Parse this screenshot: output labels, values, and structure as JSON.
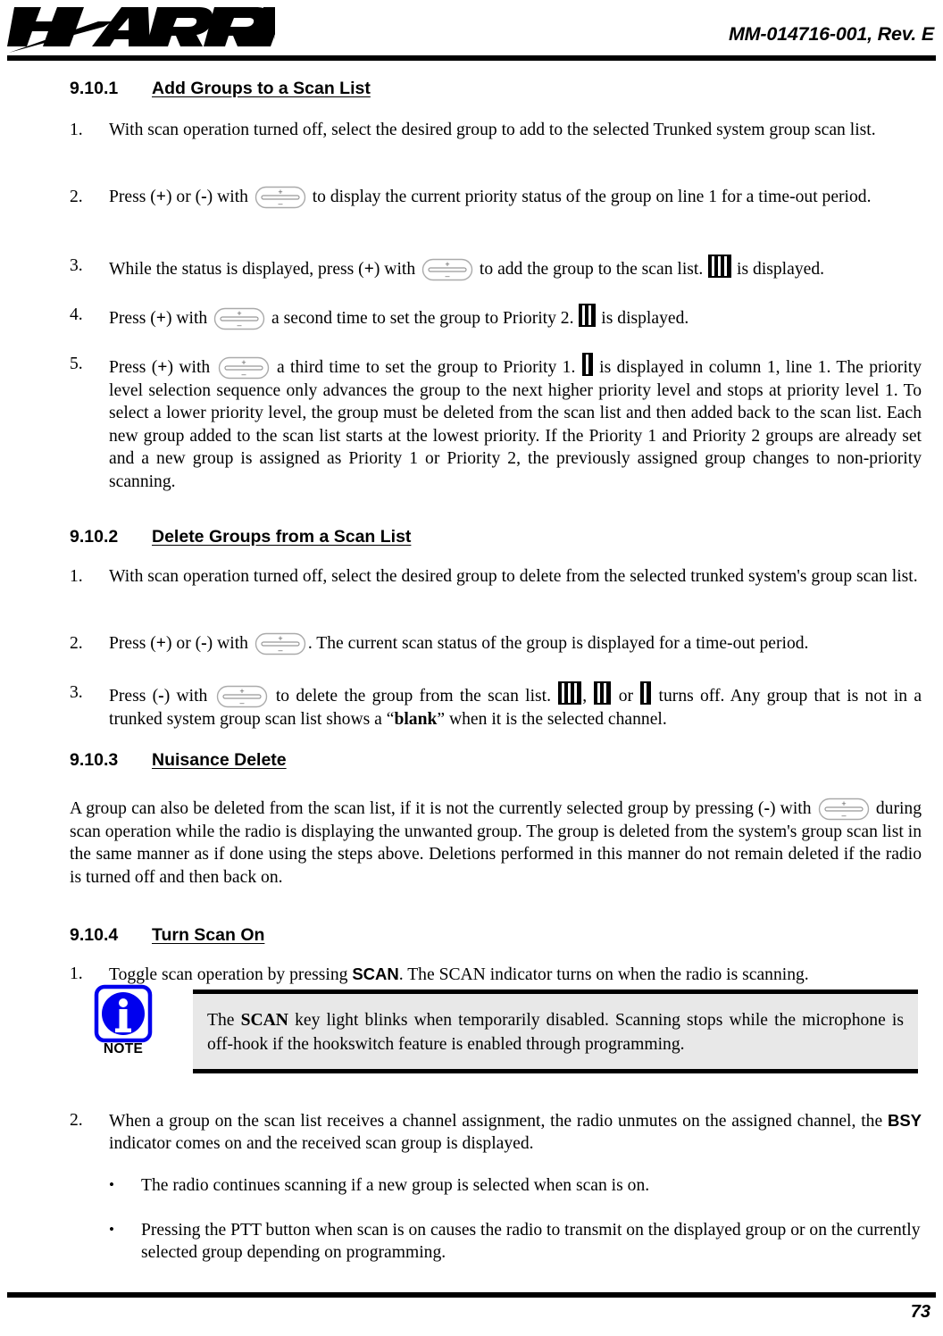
{
  "header": {
    "logo_text": "HARRIS",
    "logo_registered": "®",
    "document_id": "MM-014716-001, Rev. E"
  },
  "footer": {
    "page_number": "73"
  },
  "sections": [
    {
      "number": "9.10.1",
      "title": "Add Groups to a Scan List",
      "steps": [
        {
          "num": "1.",
          "text_a": "With scan operation turned off, select the desired group to add to the selected Trunked system group scan list."
        },
        {
          "num": "2.",
          "text_a": "Press (",
          "plus": "+",
          "text_b": ") or (",
          "minus": "-",
          "text_c": ") with ",
          "text_d": " to display the current priority status of the group on line 1 for a time-out period."
        },
        {
          "num": "3.",
          "text_a": "While the status is displayed, press (",
          "plus": "+",
          "text_c": ") with ",
          "text_d": " to add the group to the scan list. ",
          "text_e": " is displayed."
        },
        {
          "num": "4.",
          "text_a": "Press (",
          "plus": "+",
          "text_c": ") with ",
          "text_d": " a second time to set the group to Priority 2. ",
          "text_e": " is displayed."
        },
        {
          "num": "5.",
          "text_a": "Press (",
          "plus": "+",
          "text_c": ") with ",
          "text_d": " a third time to set the group to Priority 1. ",
          "text_e": " is displayed in column 1, line 1. The priority level selection sequence only advances the group to the next higher priority level and stops at priority level 1. To select a lower priority level, the group must be deleted from the scan list and then added back to the scan list. Each new group added to the scan list starts at the lowest priority. If the Priority 1 and Priority 2 groups are already set and a new group is assigned as Priority 1 or Priority 2, the previously assigned group changes to non-priority scanning."
        }
      ]
    },
    {
      "number": "9.10.2",
      "title": "Delete Groups from a Scan List",
      "steps": [
        {
          "num": "1.",
          "text_a": "With scan operation turned off, select the desired group to delete from the selected trunked system's group scan list."
        },
        {
          "num": "2.",
          "text_a": "Press (",
          "plus": "+",
          "text_b": ") or (",
          "minus": "-",
          "text_c": ") with ",
          "text_d": ". The current scan status of the group is displayed for a time-out period."
        },
        {
          "num": "3.",
          "text_a": "Press (",
          "minus": "-",
          "text_c": ") with ",
          "text_d": " to delete the group from the scan list. ",
          "sep1": ", ",
          "sep2": " or ",
          "text_e": " turns off. Any group that is not in a trunked system group scan list shows a “",
          "blank": "blank",
          "text_f": "” when it is the selected channel."
        }
      ]
    },
    {
      "number": "9.10.3",
      "title": "Nuisance Delete",
      "paragraph": {
        "text_a": "A group can also be deleted from the scan list, if it is not the currently selected group by pressing (",
        "minus": "-",
        "text_b": ") with ",
        "text_c": " during scan operation while the radio is displaying the unwanted group. The group is deleted from the system's group scan list in the same manner as if done using the steps above. Deletions performed in this manner do not remain deleted if the radio is turned off and then back on."
      }
    },
    {
      "number": "9.10.4",
      "title": "Turn Scan On",
      "steps": [
        {
          "num": "1.",
          "text_a": "Toggle scan operation by pressing ",
          "bold_scan": "SCAN",
          "text_b": ". The SCAN indicator turns on when the radio is scanning."
        },
        {
          "num": "2.",
          "text_a": "When a group on the scan list receives a channel assignment, the radio unmutes on the assigned channel, the ",
          "bold_bsy": "BSY",
          "text_b": " indicator comes on and the received scan group is displayed."
        }
      ],
      "bullets": [
        {
          "dot": "•",
          "text": "The radio continues scanning if a new group is selected when scan is on."
        },
        {
          "dot": "•",
          "text": "Pressing the PTT button when scan is on causes the radio to transmit on the displayed group or on the currently selected group depending on programming."
        }
      ]
    }
  ],
  "note": {
    "label": "NOTE",
    "icon": "info-icon",
    "text_a": "The ",
    "bold_scan": "SCAN",
    "text_b": " key light blinks when temporarily disabled. Scanning stops while the microphone is off-hook if the hookswitch feature is enabled through programming."
  },
  "colors": {
    "note_icon_blue": "#0000EE",
    "note_box_fill": "#E8E8E8",
    "rule_black": "#000000"
  },
  "icons": {
    "rocker_switch_plus": "+",
    "rocker_switch_minus": "-",
    "scan_list_indicator": "scan-list-icon",
    "priority2_indicator": "priority-2-icon",
    "priority1_indicator": "priority-1-icon"
  }
}
